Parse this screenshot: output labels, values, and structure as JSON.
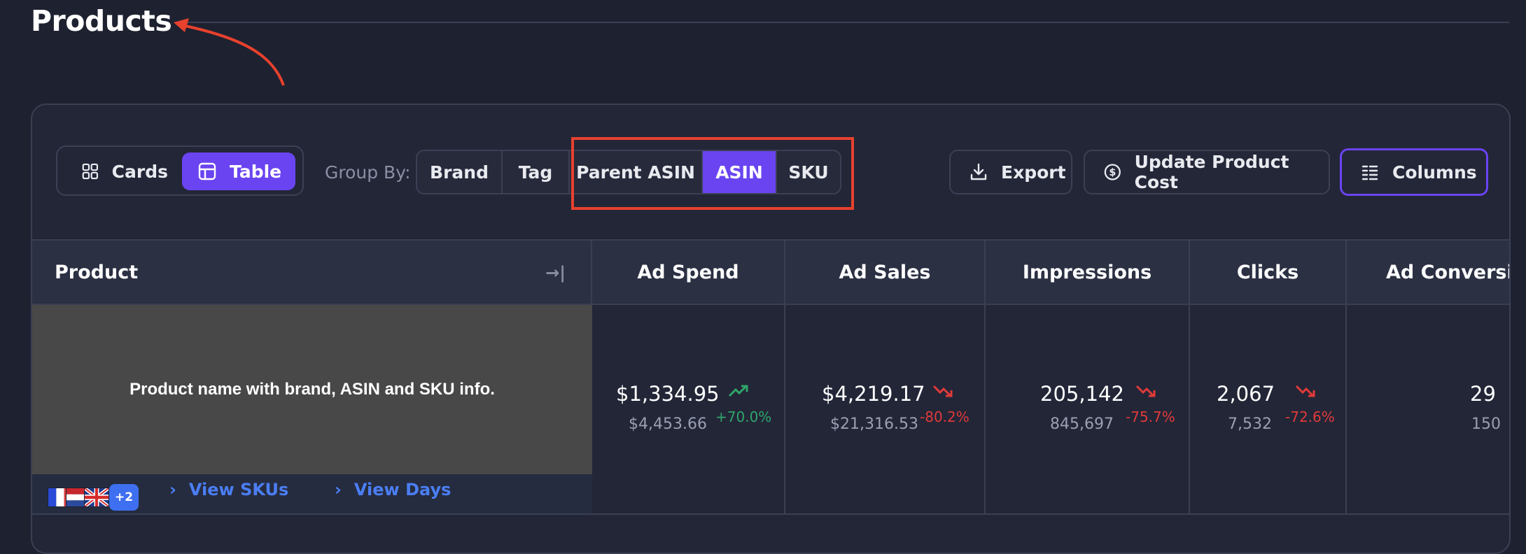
{
  "page": {
    "title": "Products"
  },
  "toolbar": {
    "view_modes": [
      {
        "label": "Cards",
        "icon": "grid-icon",
        "active": false
      },
      {
        "label": "Table",
        "icon": "table-icon",
        "active": true
      }
    ],
    "group_by_label": "Group By:",
    "group_by_options": [
      {
        "label": "Brand",
        "active": false
      },
      {
        "label": "Tag",
        "active": false
      },
      {
        "label": "Parent ASIN",
        "active": false
      },
      {
        "label": "ASIN",
        "active": true
      },
      {
        "label": "SKU",
        "active": false
      }
    ],
    "export_label": "Export",
    "update_cost_label": "Update Product Cost",
    "columns_label": "Columns"
  },
  "table": {
    "headers": [
      "Product",
      "Ad Spend",
      "Ad Sales",
      "Impressions",
      "Clicks",
      "Ad Conversi"
    ],
    "rows": [
      {
        "product_placeholder": "Product name with brand, ASIN and SKU info.",
        "extra_marketplaces": "+2",
        "view_skus": "View SKUs",
        "view_days": "View Days",
        "metrics": [
          {
            "value": "$1,334.95",
            "previous": "$4,453.66",
            "change": "+70.0%",
            "direction": "up"
          },
          {
            "value": "$4,219.17",
            "previous": "$21,316.53",
            "change": "-80.2%",
            "direction": "down"
          },
          {
            "value": "205,142",
            "previous": "845,697",
            "change": "-75.7%",
            "direction": "down"
          },
          {
            "value": "2,067",
            "previous": "7,532",
            "change": "-72.6%",
            "direction": "down"
          },
          {
            "value": "29",
            "previous": "150",
            "change": "",
            "direction": ""
          }
        ]
      }
    ]
  },
  "colors": {
    "accent": "#6a44f0",
    "background": "#1e2130",
    "up": "#2fa56a",
    "down": "#e13a3a",
    "annotation": "#e8412d",
    "link": "#4b7ef5"
  }
}
